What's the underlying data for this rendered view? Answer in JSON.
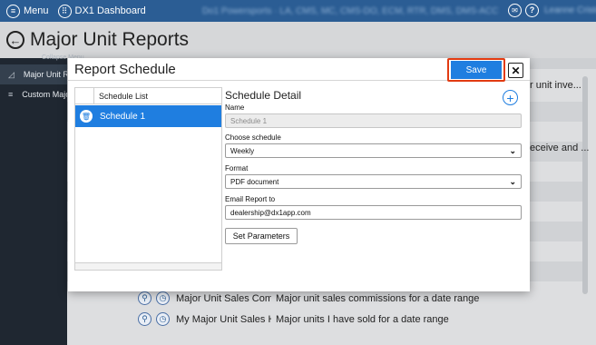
{
  "topbar": {
    "menu_label": "Menu",
    "app_title": "DX1 Dashboard",
    "blurred_info": "Do1 Powersports · LA, CMS, MC, CMS-DO, ECM, RTR, DMS, DMS-ACC",
    "user_name": "Leanne Cristo"
  },
  "page": {
    "title": "Major Unit Reports"
  },
  "sidebar": {
    "menu_caption": "Collapse Menu",
    "items": [
      {
        "label": "Major Unit Reports",
        "icon": "chart-icon",
        "active": true
      },
      {
        "label": "Custom Major Unit Reports",
        "icon": "list-icon",
        "active": false
      }
    ]
  },
  "background_table": {
    "right_snippets": [
      "r unit inve...",
      "eceive and ..."
    ],
    "rows": [
      {
        "name": "Major Unit Sales Comm...",
        "description": "Major unit sales commissions for a date range"
      },
      {
        "name": "My Major Unit Sales His...",
        "description": "Major units I have sold for a date range"
      }
    ]
  },
  "modal": {
    "title": "Report Schedule",
    "save_label": "Save",
    "close_symbol": "✕",
    "schedule_list": {
      "header": "Schedule List",
      "items": [
        {
          "label": "Schedule 1",
          "selected": true
        }
      ]
    },
    "detail": {
      "title": "Schedule Detail",
      "name_label": "Name",
      "name_placeholder": "Schedule 1",
      "schedule_label": "Choose schedule",
      "schedule_value": "Weekly",
      "format_label": "Format",
      "format_value": "PDF document",
      "email_label": "Email Report to",
      "email_value": "dealership@dx1app.com",
      "params_button": "Set Parameters"
    }
  },
  "colors": {
    "topbar": "#2b5d94",
    "accent": "#1f7ee0",
    "highlight": "#e23b12",
    "sidebar": "#1f2731"
  }
}
